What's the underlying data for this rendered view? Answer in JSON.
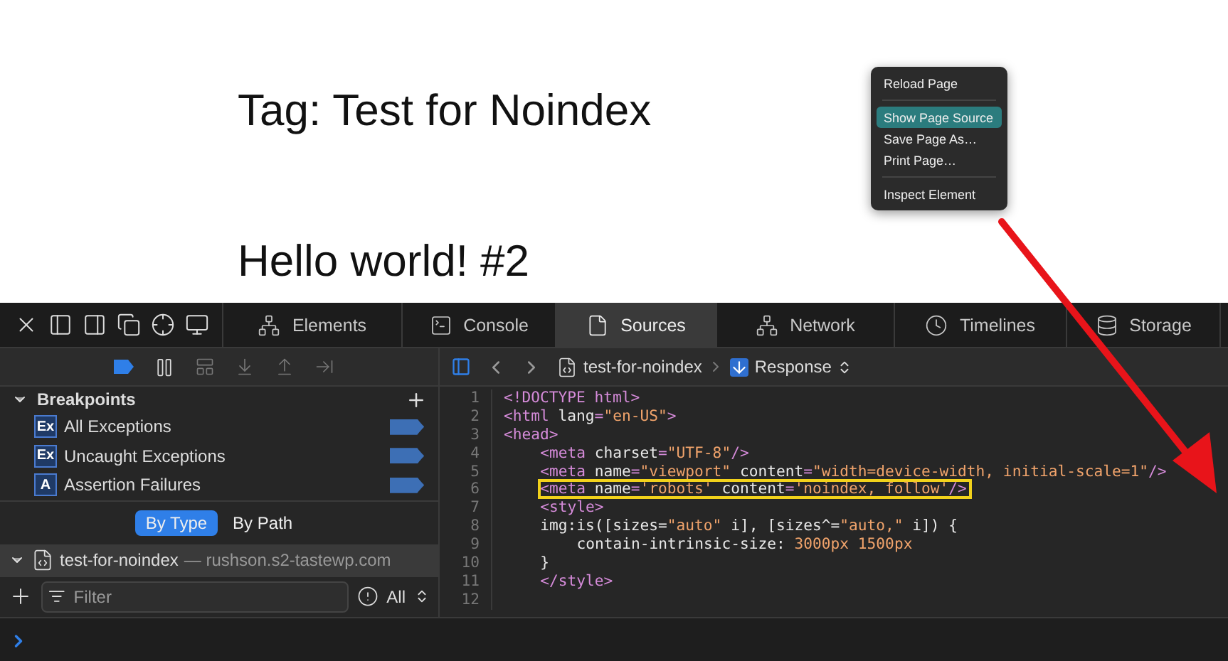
{
  "page": {
    "title": "Tag: Test for Noindex",
    "post_title": "Hello world! #2"
  },
  "context_menu": {
    "groups": [
      [
        {
          "label": "Reload Page",
          "selected": false
        }
      ],
      [
        {
          "label": "Show Page Source",
          "selected": true
        },
        {
          "label": "Save Page As…",
          "selected": false
        },
        {
          "label": "Print Page…",
          "selected": false
        }
      ],
      [
        {
          "label": "Inspect Element",
          "selected": false
        }
      ]
    ]
  },
  "devtools": {
    "tabs": [
      {
        "label": "Elements",
        "selected": false
      },
      {
        "label": "Console",
        "selected": false
      },
      {
        "label": "Sources",
        "selected": true
      },
      {
        "label": "Network",
        "selected": false
      },
      {
        "label": "Timelines",
        "selected": false
      },
      {
        "label": "Storage",
        "selected": false
      }
    ],
    "breakpoints": {
      "title": "Breakpoints",
      "expanded": true,
      "items": [
        {
          "badge": "Ex",
          "label": "All Exceptions",
          "enabled": true
        },
        {
          "badge": "Ex",
          "label": "Uncaught Exceptions",
          "enabled": true
        },
        {
          "badge": "A",
          "label": "Assertion Failures",
          "enabled": true
        }
      ]
    },
    "group_by": [
      {
        "label": "By Type",
        "selected": true
      },
      {
        "label": "By Path",
        "selected": false
      }
    ],
    "resource": {
      "name": "test-for-noindex",
      "origin": "— rushson.s2-tastewp.com",
      "expanded": true
    },
    "filter": {
      "placeholder": "Filter",
      "scope": "All"
    },
    "breadcrumb": {
      "file": "test-for-noindex",
      "source": "Response"
    },
    "code_lines": [
      {
        "number": "1",
        "kind": "top",
        "highlighted": false,
        "tokens": [
          {
            "kind": "tag",
            "text": "<!DOCTYPE html>"
          }
        ]
      },
      {
        "number": "2",
        "kind": "top",
        "highlighted": false,
        "tokens": [
          {
            "kind": "tag",
            "text": "<html "
          },
          {
            "kind": "attr",
            "text": "lang"
          },
          {
            "kind": "tag",
            "text": "="
          },
          {
            "kind": "value",
            "text": "\"en-US\""
          },
          {
            "kind": "tag",
            "text": ">"
          }
        ]
      },
      {
        "number": "3",
        "kind": "top",
        "highlighted": false,
        "tokens": [
          {
            "kind": "tag",
            "text": "<head>"
          }
        ]
      },
      {
        "number": "4",
        "kind": "inner",
        "highlighted": false,
        "tokens": [
          {
            "kind": "tag",
            "text": "<meta "
          },
          {
            "kind": "attr",
            "text": "charset"
          },
          {
            "kind": "tag",
            "text": "="
          },
          {
            "kind": "value",
            "text": "\"UTF-8\""
          },
          {
            "kind": "tag",
            "text": "/>"
          }
        ]
      },
      {
        "number": "5",
        "kind": "inner",
        "highlighted": false,
        "tokens": [
          {
            "kind": "tag",
            "text": "<meta "
          },
          {
            "kind": "attr",
            "text": "name"
          },
          {
            "kind": "tag",
            "text": "="
          },
          {
            "kind": "value",
            "text": "\"viewport\" "
          },
          {
            "kind": "attr",
            "text": "content"
          },
          {
            "kind": "tag",
            "text": "="
          },
          {
            "kind": "value",
            "text": "\"width=device-width, initial-scale=1\""
          },
          {
            "kind": "tag",
            "text": "/>"
          }
        ]
      },
      {
        "number": "6",
        "kind": "inner",
        "highlighted": true,
        "tokens": [
          {
            "kind": "tag",
            "text": "<meta "
          },
          {
            "kind": "attr",
            "text": "name"
          },
          {
            "kind": "tag",
            "text": "="
          },
          {
            "kind": "value",
            "text": "'robots' "
          },
          {
            "kind": "attr",
            "text": "content"
          },
          {
            "kind": "tag",
            "text": "="
          },
          {
            "kind": "value",
            "text": "'noindex, follow'"
          },
          {
            "kind": "tag",
            "text": "/>"
          }
        ]
      },
      {
        "number": "7",
        "kind": "inner",
        "highlighted": false,
        "tokens": [
          {
            "kind": "tag",
            "text": "<style>"
          }
        ]
      },
      {
        "number": "8",
        "kind": "inner",
        "highlighted": false,
        "tokens": [
          {
            "kind": "plain",
            "text": "img:"
          },
          {
            "kind": "attr",
            "text": "is"
          },
          {
            "kind": "plain",
            "text": "([sizes="
          },
          {
            "kind": "value",
            "text": "\"auto\""
          },
          {
            "kind": "plain",
            "text": " i], [sizes^="
          },
          {
            "kind": "value",
            "text": "\"auto,\""
          },
          {
            "kind": "plain",
            "text": " i]) {"
          }
        ]
      },
      {
        "number": "9",
        "kind": "deep",
        "highlighted": false,
        "tokens": [
          {
            "kind": "attr",
            "text": "contain-intrinsic-size"
          },
          {
            "kind": "plain",
            "text": ": "
          },
          {
            "kind": "value",
            "text": "3000px 1500px"
          }
        ]
      },
      {
        "number": "10",
        "kind": "inner",
        "highlighted": false,
        "tokens": [
          {
            "kind": "plain",
            "text": "}"
          }
        ]
      },
      {
        "number": "11",
        "kind": "inner",
        "highlighted": false,
        "tokens": [
          {
            "kind": "tag",
            "text": "</style>"
          }
        ]
      },
      {
        "number": "12",
        "kind": "top"
      }
    ]
  }
}
